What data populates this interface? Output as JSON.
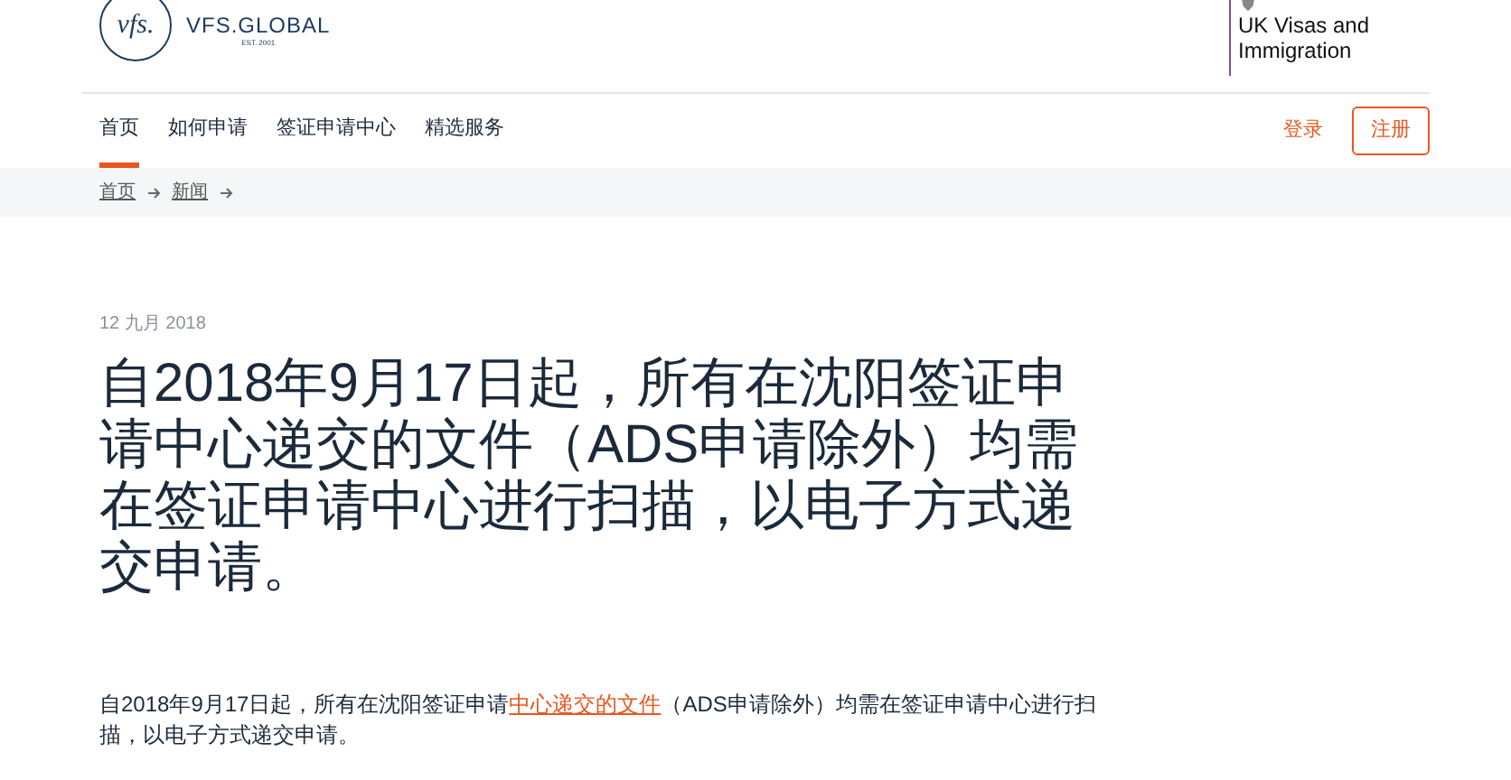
{
  "header": {
    "logo_mark": "vfs.",
    "logo_name": "VFS.GLOBAL",
    "logo_est": "EST. 2001",
    "partner": "UK Visas and Immigration"
  },
  "nav": {
    "items": [
      {
        "label": "首页",
        "selected": true
      },
      {
        "label": "如何申请",
        "selected": false
      },
      {
        "label": "签证申请中心",
        "selected": false
      },
      {
        "label": "精选服务",
        "selected": false
      }
    ],
    "login": "登录",
    "register": "注册"
  },
  "breadcrumb": [
    "首页",
    "新闻"
  ],
  "article": {
    "date": "12 九月 2018",
    "title": "自2018年9月17日起，所有在沈阳签证申请中心递交的文件（ADS申请除外）均需在签证申请中心进行扫描，以电子方式递交申请。",
    "paragraph": {
      "before": "自2018年9月17日起，所有在沈阳签证申请",
      "link": "中心递交的文件",
      "after": "（ADS申请除外）均需在签证申请中心进行扫描，以电子方式递交申请。"
    }
  }
}
